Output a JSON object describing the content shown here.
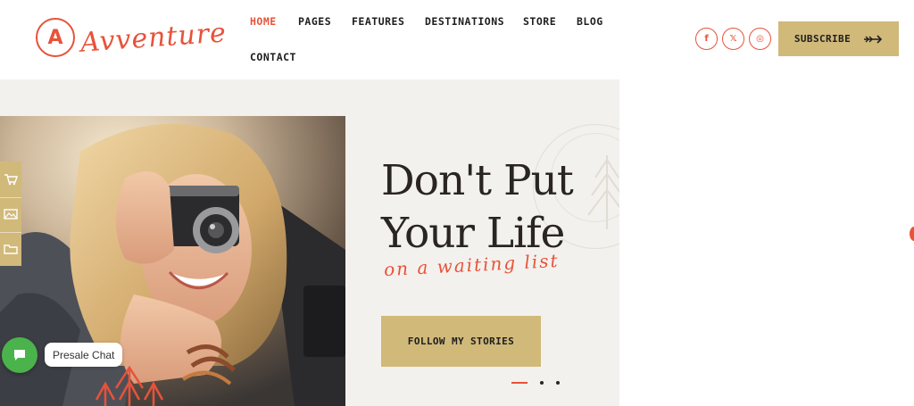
{
  "brand": {
    "badge_letter": "A",
    "name": "Avventure",
    "accent_color": "#e8523a",
    "button_color": "#d1b97a"
  },
  "nav": {
    "items": [
      {
        "label": "HOME",
        "active": true
      },
      {
        "label": "PAGES",
        "active": false
      },
      {
        "label": "FEATURES",
        "active": false
      },
      {
        "label": "DESTINATIONS",
        "active": false
      },
      {
        "label": "STORE",
        "active": false
      },
      {
        "label": "BLOG",
        "active": false
      },
      {
        "label": "CONTACT",
        "active": false
      }
    ]
  },
  "social": [
    {
      "icon": "facebook-icon",
      "glyph": "f"
    },
    {
      "icon": "x-twitter-icon",
      "glyph": "𝕏"
    },
    {
      "icon": "instagram-icon",
      "glyph": "◎"
    }
  ],
  "subscribe": {
    "label": "SUBSCRIBE",
    "icon": "long-arrow-right-icon"
  },
  "hero": {
    "headline_line1": "Don't Put",
    "headline_line2": "Your Life",
    "script_line": "on a waiting list",
    "cta_label": "FOLLOW MY STORIES",
    "slides_total": 3,
    "slide_active": 1
  },
  "side_dock": [
    {
      "icon": "cart-icon"
    },
    {
      "icon": "image-icon"
    },
    {
      "icon": "folder-icon"
    }
  ],
  "chat": {
    "label": "Presale Chat",
    "icon": "chat-icon"
  }
}
